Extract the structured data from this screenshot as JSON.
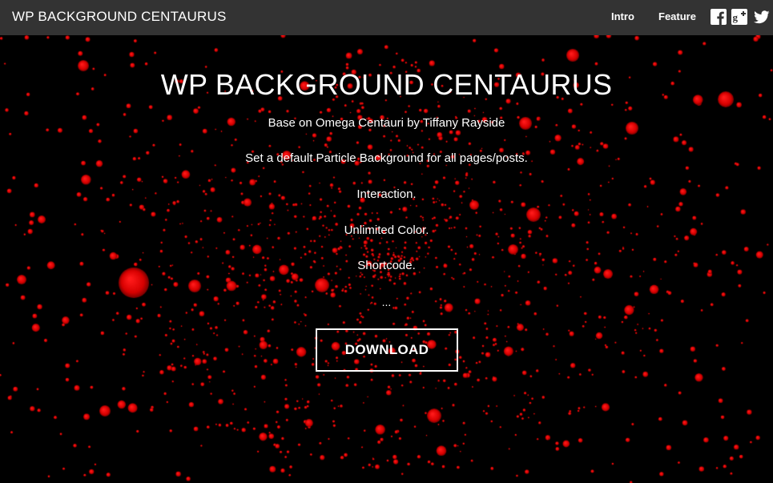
{
  "navbar": {
    "brand": "WP BACKGROUND CENTAURUS",
    "links": [
      {
        "label": "Intro"
      },
      {
        "label": "Feature"
      }
    ],
    "social_icons": [
      "facebook-icon",
      "google-plus-icon",
      "twitter-icon"
    ]
  },
  "hero": {
    "title": "WP BACKGROUND CENTAURUS",
    "lines": [
      "Base on Omega Centauri by Tiffany Rayside",
      "Set a default Particle Background for all pages/posts.",
      "Interaction.",
      "Unlimited Color.",
      "Shortcode.",
      "..."
    ],
    "download_label": "DOWNLOAD"
  },
  "colors": {
    "background": "#000000",
    "navbar": "#333333",
    "particle": "#e00000",
    "text": "#ffffff"
  }
}
